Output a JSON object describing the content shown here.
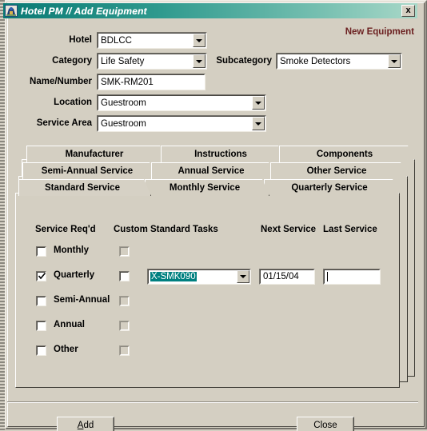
{
  "window": {
    "title": "Hotel PM // Add Equipment",
    "icon": "application-icon",
    "close_label": "×",
    "close_glyph": "x"
  },
  "header": {
    "note": "New Equipment"
  },
  "form": {
    "hotel": {
      "label": "Hotel",
      "value": "BDLCC",
      "type": "combobox"
    },
    "category": {
      "label": "Category",
      "value": "Life Safety",
      "type": "combobox"
    },
    "subcategory": {
      "label": "Subcategory",
      "value": "Smoke Detectors",
      "type": "combobox"
    },
    "name_number": {
      "label": "Name/Number",
      "value": "SMK-RM201",
      "type": "textbox"
    },
    "location": {
      "label": "Location",
      "value": "Guestroom",
      "type": "combobox"
    },
    "service_area": {
      "label": "Service Area",
      "value": "Guestroom",
      "type": "combobox"
    }
  },
  "tabs": {
    "row1": [
      "Manufacturer",
      "Instructions",
      "Components"
    ],
    "row2": [
      "Semi-Annual Service",
      "Annual Service",
      "Other Service"
    ],
    "row3": [
      "Standard Service",
      "Monthly Service",
      "Quarterly Service"
    ],
    "active": "Standard Service"
  },
  "panel": {
    "columns": {
      "service_reqd": "Service Req'd",
      "custom": "Custom",
      "standard_tasks": "Standard Tasks",
      "custom_standard_tasks": "Custom Standard Tasks",
      "next_service": "Next Service",
      "last_service": "Last Service"
    },
    "rows": [
      {
        "name": "Monthly",
        "service_reqd": false,
        "custom": false,
        "custom_enabled": false,
        "task": null,
        "next_service": null,
        "last_service": null
      },
      {
        "name": "Quarterly",
        "service_reqd": true,
        "custom": false,
        "custom_enabled": true,
        "task": "X-SMK090",
        "next_service": "01/15/04",
        "last_service": ""
      },
      {
        "name": "Semi-Annual",
        "service_reqd": false,
        "custom": false,
        "custom_enabled": false,
        "task": null,
        "next_service": null,
        "last_service": null
      },
      {
        "name": "Annual",
        "service_reqd": false,
        "custom": false,
        "custom_enabled": false,
        "task": null,
        "next_service": null,
        "last_service": null
      },
      {
        "name": "Other",
        "service_reqd": false,
        "custom": false,
        "custom_enabled": false,
        "task": null,
        "next_service": null,
        "last_service": null
      }
    ]
  },
  "footer": {
    "add": {
      "accel": "A",
      "rest": "dd"
    },
    "close": "Close"
  },
  "colors": {
    "face": "#d4cfc2",
    "titlebar_start": "#0a7a74",
    "titlebar_end": "#a9d8c8",
    "accent_note": "#6b2020",
    "selection": "#008080",
    "field_bg": "#ffffff"
  }
}
